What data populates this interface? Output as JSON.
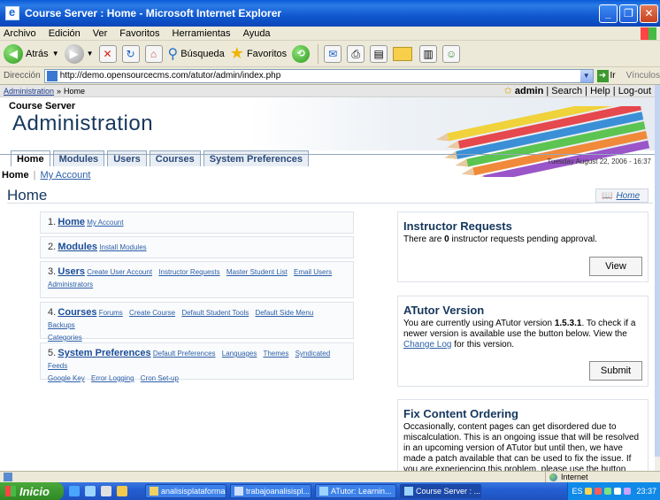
{
  "window": {
    "title": "Course Server : Home - Microsoft Internet Explorer",
    "controls": [
      "_",
      "❐",
      "✕"
    ]
  },
  "menu": [
    "Archivo",
    "Edición",
    "Ver",
    "Favoritos",
    "Herramientas",
    "Ayuda"
  ],
  "toolbar": {
    "back": "Atrás",
    "search": "Búsqueda",
    "favorites": "Favoritos"
  },
  "address": {
    "label": "Dirección",
    "url": "http://demo.opensourcecms.com/atutor/admin/index.php",
    "go": "Ir",
    "links": "Vínculos"
  },
  "crumb": {
    "root": "Administration",
    "sep": "»",
    "current": "Home",
    "user": "admin",
    "links": "| Search | Help | Log-out"
  },
  "header": {
    "site": "Course Server",
    "title": "Administration"
  },
  "tabs": [
    "Home",
    "Modules",
    "Users",
    "Courses",
    "System Preferences"
  ],
  "date": "Tuesday August 22, 2006 - 16:37",
  "subnav": {
    "current": "Home",
    "sep": "|",
    "link": "My Account"
  },
  "page": {
    "title": "Home",
    "help": "Home"
  },
  "menu_boxes": [
    {
      "num": "1.",
      "main": "Home",
      "subs": [
        "My Account"
      ]
    },
    {
      "num": "2.",
      "main": "Modules",
      "subs": [
        "Install Modules"
      ]
    },
    {
      "num": "3.",
      "main": "Users",
      "subs": [
        "Create User Account",
        "Instructor Requests",
        "Master Student List",
        "Email Users",
        "Administrators"
      ]
    },
    {
      "num": "4.",
      "main": "Courses",
      "subs": [
        "Forums",
        "Create Course",
        "Default Student Tools",
        "Default Side Menu",
        "Backups",
        "Categories"
      ]
    },
    {
      "num": "5.",
      "main": "System Preferences",
      "subs": [
        "Default Preferences",
        "Languages",
        "Themes",
        "Syndicated Feeds",
        "Google Key",
        "Error Logging",
        "Cron Set-up"
      ]
    }
  ],
  "panels": {
    "instructor": {
      "title": "Instructor Requests",
      "text_before": "There are ",
      "count": "0",
      "text_after": " instructor requests pending approval.",
      "button": "View"
    },
    "version": {
      "title": "ATutor Version",
      "text_before": "You are currently using ATutor version ",
      "version": "1.5.3.1",
      "text_after": ". To check if a newer version is available use the button below. View the ",
      "link": "Change Log",
      "text_end": " for this version.",
      "button": "Submit"
    },
    "ordering": {
      "title": "Fix Content Ordering",
      "text": "Occasionally, content pages can get disordered due to miscalculation. This is an ongoing issue that will be resolved in an upcoming version of ATutor but until then, we have made a patch available that can be used to fix the issue. If you are experiencing this problem, please use the button below."
    }
  },
  "statusbar": {
    "zone": "Internet"
  },
  "taskbar": {
    "start": "Inicio",
    "tasks": [
      "analisisplataformas",
      "trabajoanalisispl...",
      "ATutor: Learnin...",
      "Course Server : ..."
    ],
    "tray_lang": "ES",
    "clock": "23:37"
  },
  "colors": {
    "accent": "#15375c",
    "link": "#2b5fa8",
    "titlebar": "#0a5ad8"
  }
}
